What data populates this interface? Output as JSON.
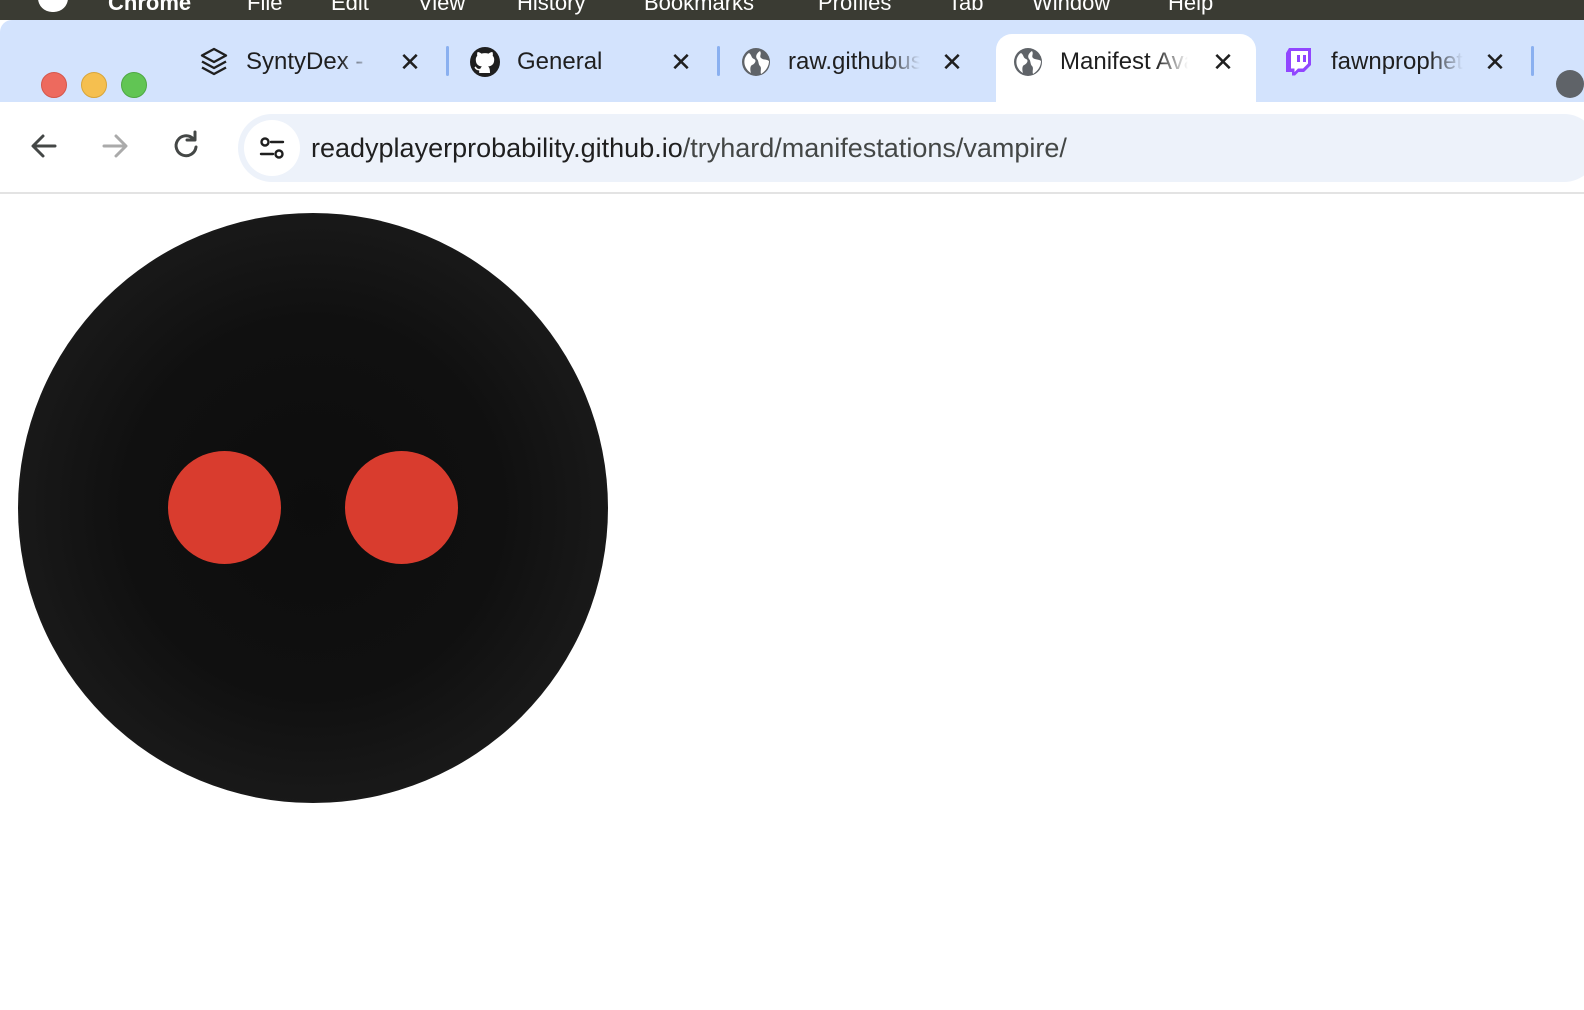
{
  "menubar": {
    "app_name": "Chrome",
    "items": [
      "File",
      "Edit",
      "View",
      "History",
      "Bookmarks",
      "Profiles",
      "Tab",
      "Window",
      "Help"
    ]
  },
  "tabs": [
    {
      "title": "SyntyDex - Manage",
      "icon": "syntydex-layers-icon",
      "active": false
    },
    {
      "title": "General",
      "icon": "github-icon",
      "active": false
    },
    {
      "title": "raw.githubusercontent.com",
      "icon": "globe-icon",
      "active": false
    },
    {
      "title": "Manifest Avatar",
      "icon": "globe-icon",
      "active": true
    },
    {
      "title": "fawnprophet - Twitch",
      "icon": "twitch-icon",
      "active": false
    }
  ],
  "address_bar": {
    "host": "readyplayerprobability.github.io",
    "path": "/tryhard/manifestations/vampire/"
  },
  "avatar": {
    "face_color": "#111111",
    "eye_color": "#d93c2e"
  },
  "colors": {
    "tabstrip": "#d3e3fd",
    "omnibox": "#edf2fa",
    "twitch_purple": "#9146ff"
  }
}
